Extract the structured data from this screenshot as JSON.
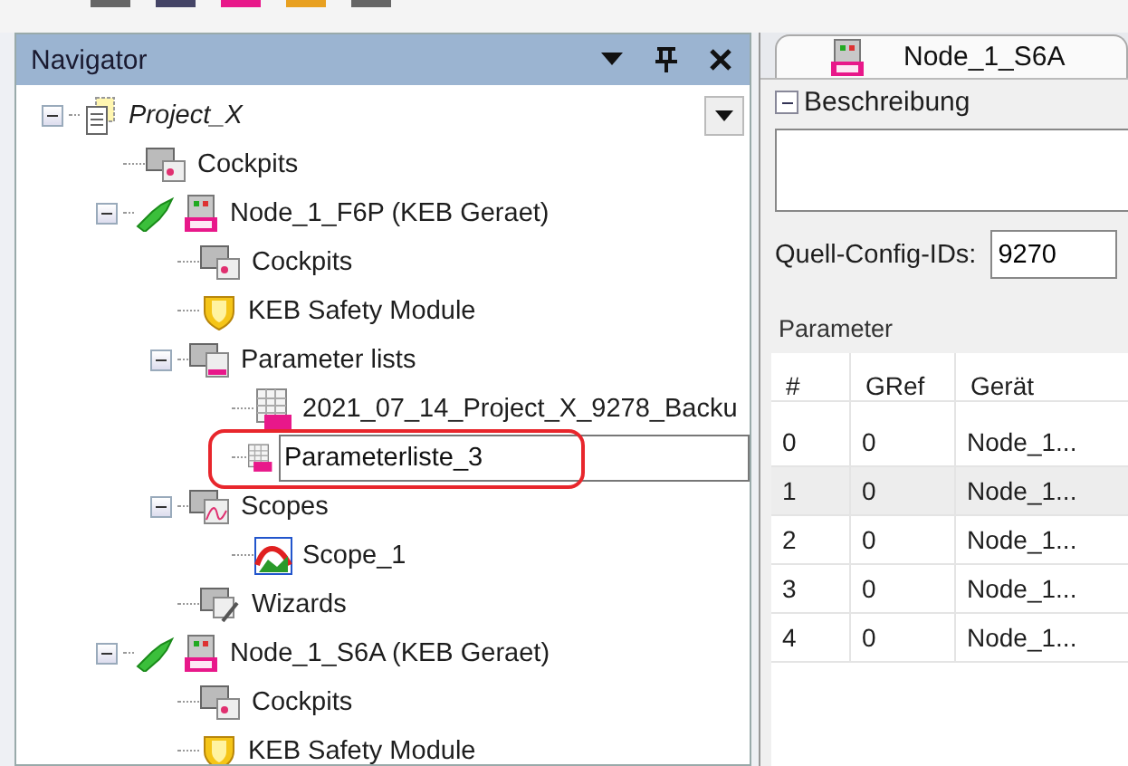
{
  "navigator": {
    "title": "Navigator",
    "tree": [
      {
        "label": "Project_X",
        "kind": "project",
        "expanded": true,
        "editing": false,
        "children": [
          {
            "label": "Cockpits",
            "kind": "cockpits",
            "editing": false
          },
          {
            "label": "Node_1_F6P (KEB Geraet)",
            "kind": "node",
            "expanded": true,
            "editing": false,
            "children": [
              {
                "label": "Cockpits",
                "kind": "cockpits",
                "editing": false
              },
              {
                "label": "KEB Safety Module",
                "kind": "safety",
                "editing": false
              },
              {
                "label": "Parameter lists",
                "kind": "paramlists",
                "expanded": true,
                "editing": false,
                "children": [
                  {
                    "label": "2021_07_14_Project_X_9278_Backu",
                    "kind": "paramlist",
                    "editing": false
                  },
                  {
                    "label": "Parameterliste_3",
                    "kind": "paramlist",
                    "editing": true
                  }
                ]
              },
              {
                "label": "Scopes",
                "kind": "scopes",
                "expanded": true,
                "editing": false,
                "children": [
                  {
                    "label": "Scope_1",
                    "kind": "scope",
                    "editing": false
                  }
                ]
              },
              {
                "label": "Wizards",
                "kind": "wizards",
                "editing": false
              }
            ]
          },
          {
            "label": "Node_1_S6A (KEB Geraet)",
            "kind": "node",
            "expanded": true,
            "editing": false,
            "children": [
              {
                "label": "Cockpits",
                "kind": "cockpits",
                "editing": false
              },
              {
                "label": "KEB Safety Module",
                "kind": "safety",
                "editing": false
              }
            ]
          }
        ]
      }
    ]
  },
  "editor": {
    "tab": {
      "label": "Node_1_S6A",
      "selected": true
    },
    "description": {
      "title": "Beschreibung",
      "expanded": true
    },
    "config_ids": {
      "label": "Quell-Config-IDs:",
      "value": "9270"
    },
    "parameter": {
      "title": "Parameter",
      "columns": [
        "#",
        "GRef",
        "Gerät"
      ],
      "rows": [
        {
          "cells": [
            "0",
            "0",
            "Node_1..."
          ],
          "selected": false
        },
        {
          "cells": [
            "1",
            "0",
            "Node_1..."
          ],
          "selected": true
        },
        {
          "cells": [
            "2",
            "0",
            "Node_1..."
          ],
          "selected": false
        },
        {
          "cells": [
            "3",
            "0",
            "Node_1..."
          ],
          "selected": false
        },
        {
          "cells": [
            "4",
            "0",
            "Node_1..."
          ],
          "selected": false
        }
      ]
    }
  }
}
